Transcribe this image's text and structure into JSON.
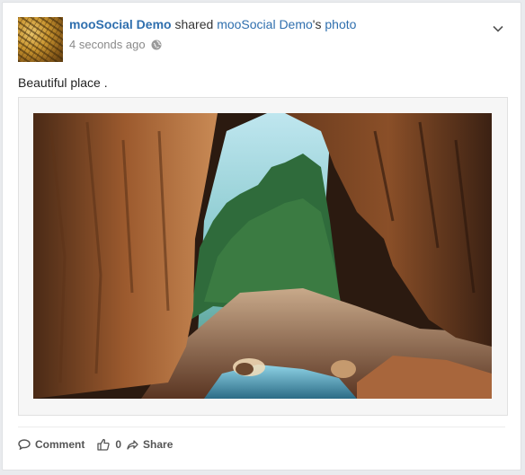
{
  "post": {
    "author": "mooSocial Demo",
    "action_text": "shared",
    "owner": "mooSocial Demo",
    "owner_suffix": "'s",
    "object_link": "photo",
    "timestamp": "4 seconds ago",
    "privacy_icon": "globe-icon",
    "caption": "Beautiful place ."
  },
  "actions": {
    "comment_label": "Comment",
    "like_count": "0",
    "share_label": "Share"
  },
  "colors": {
    "link": "#2f6fae",
    "text": "#333333",
    "muted": "#8a8a8a"
  }
}
